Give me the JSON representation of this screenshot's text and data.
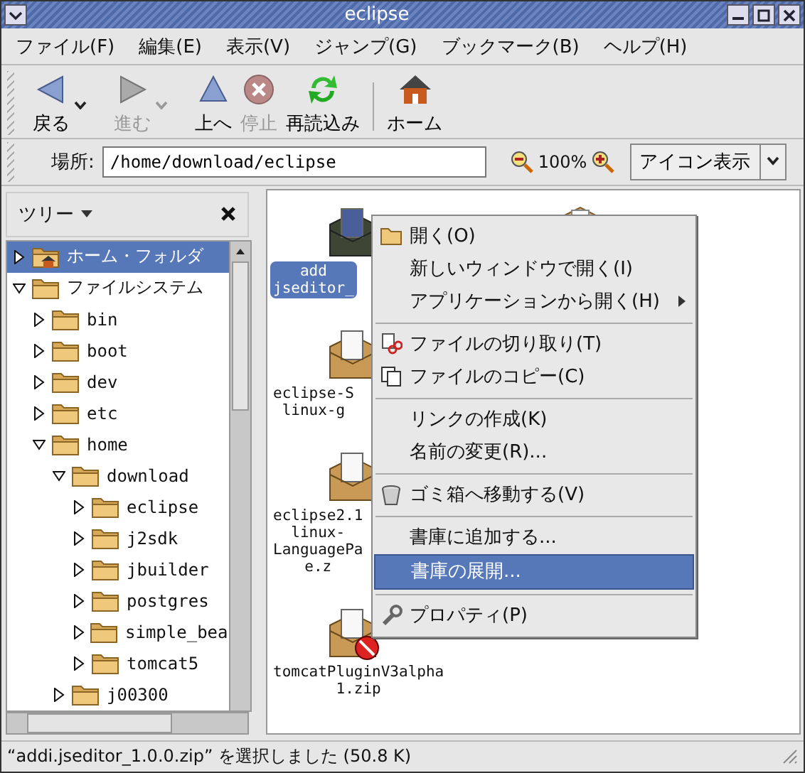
{
  "window": {
    "title": "eclipse"
  },
  "menubar": [
    "ファイル(F)",
    "編集(E)",
    "表示(V)",
    "ジャンプ(G)",
    "ブックマーク(B)",
    "ヘルプ(H)"
  ],
  "toolbar": [
    {
      "kind": "back",
      "label": "戻る",
      "disabled": false,
      "has_menu": true
    },
    {
      "kind": "forward",
      "label": "進む",
      "disabled": true,
      "has_menu": true
    },
    {
      "kind": "up",
      "label": "上へ",
      "disabled": false,
      "has_menu": false
    },
    {
      "kind": "stop",
      "label": "停止",
      "disabled": true,
      "has_menu": false
    },
    {
      "kind": "reload",
      "label": "再読込み",
      "disabled": false,
      "has_menu": false
    },
    {
      "kind": "separator"
    },
    {
      "kind": "home",
      "label": "ホーム",
      "disabled": false,
      "has_menu": false
    }
  ],
  "location": {
    "label": "場所:",
    "value": "/home/download/eclipse",
    "zoom": "100%",
    "view": "アイコン表示"
  },
  "sidebar": {
    "title": "ツリー",
    "tree": [
      {
        "label": "ホーム・フォルダ",
        "kind": "home",
        "selected": true,
        "expanded": false
      },
      {
        "label": "ファイルシステム",
        "kind": "folder",
        "selected": false,
        "expanded": true,
        "children": [
          {
            "label": "bin",
            "kind": "folder",
            "selected": false,
            "expanded": false
          },
          {
            "label": "boot",
            "kind": "folder",
            "selected": false,
            "expanded": false
          },
          {
            "label": "dev",
            "kind": "folder",
            "selected": false,
            "expanded": false
          },
          {
            "label": "etc",
            "kind": "folder",
            "selected": false,
            "expanded": false
          },
          {
            "label": "home",
            "kind": "folder",
            "selected": false,
            "expanded": true,
            "children": [
              {
                "label": "download",
                "kind": "folder",
                "selected": false,
                "expanded": true,
                "children": [
                  {
                    "label": "eclipse",
                    "kind": "folder",
                    "selected": false,
                    "expanded": false
                  },
                  {
                    "label": "j2sdk",
                    "kind": "folder",
                    "selected": false,
                    "expanded": false
                  },
                  {
                    "label": "jbuilder",
                    "kind": "folder",
                    "selected": false,
                    "expanded": false
                  },
                  {
                    "label": "postgres",
                    "kind": "folder",
                    "selected": false,
                    "expanded": false
                  },
                  {
                    "label": "simple_bea",
                    "kind": "folder",
                    "selected": false,
                    "expanded": false
                  },
                  {
                    "label": "tomcat5",
                    "kind": "folder",
                    "selected": false,
                    "expanded": false
                  }
                ]
              },
              {
                "label": "j00300",
                "kind": "folder",
                "selected": false,
                "expanded": false
              }
            ]
          }
        ]
      }
    ]
  },
  "files": [
    {
      "lines": [
        "add",
        "jseditor_"
      ],
      "kind": "archive",
      "selected": true
    },
    {
      "lines": [
        "eclipse-S",
        "linux-g"
      ],
      "kind": "archive",
      "selected": false
    },
    {
      "lines": [
        "eclipse2.1",
        "linux-",
        "LanguagePa",
        "e.z"
      ],
      "kind": "archive",
      "selected": false
    },
    {
      "lines": [
        "tomcatPluginV3alpha",
        "1.zip"
      ],
      "kind": "archive_prohibited",
      "selected": false
    }
  ],
  "context_menu": [
    {
      "kind": "folder",
      "label": "開く(O)",
      "selected": false,
      "submenu": false
    },
    {
      "kind": "text",
      "label": "新しいウィンドウで開く(I)",
      "selected": false,
      "submenu": false
    },
    {
      "kind": "text",
      "label": "アプリケーションから開く(H)",
      "selected": false,
      "submenu": true
    },
    {
      "kind": "separator"
    },
    {
      "kind": "cut",
      "label": "ファイルの切り取り(T)",
      "selected": false,
      "submenu": false
    },
    {
      "kind": "copy",
      "label": "ファイルのコピー(C)",
      "selected": false,
      "submenu": false
    },
    {
      "kind": "separator"
    },
    {
      "kind": "text",
      "label": "リンクの作成(K)",
      "selected": false,
      "submenu": false
    },
    {
      "kind": "text",
      "label": "名前の変更(R)...",
      "selected": false,
      "submenu": false
    },
    {
      "kind": "separator"
    },
    {
      "kind": "trash",
      "label": "ゴミ箱へ移動する(V)",
      "selected": false,
      "submenu": false
    },
    {
      "kind": "separator"
    },
    {
      "kind": "text",
      "label": "書庫に追加する...",
      "selected": false,
      "submenu": false
    },
    {
      "kind": "text",
      "label": "書庫の展開...",
      "selected": true,
      "submenu": false
    },
    {
      "kind": "separator"
    },
    {
      "kind": "wrench",
      "label": "プロパティ(P)",
      "selected": false,
      "submenu": false
    }
  ],
  "status_bar": "“addi.jseditor_1.0.0.zip” を選択しました (50.8 K)"
}
